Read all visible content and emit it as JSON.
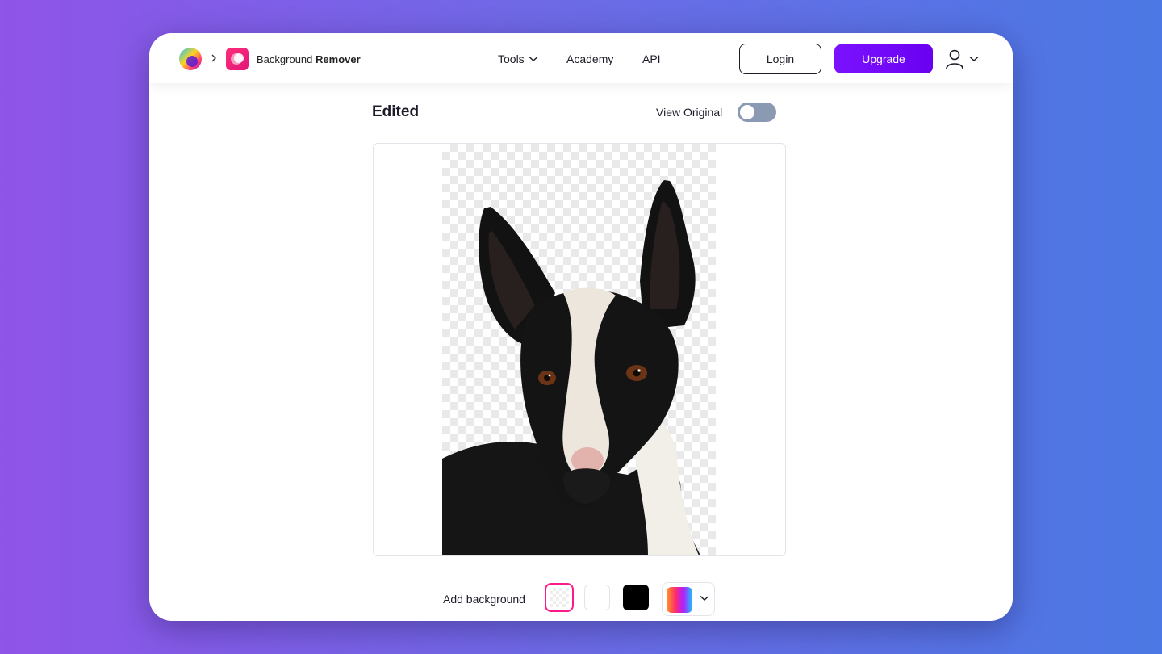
{
  "header": {
    "app_name_regular": "Background",
    "app_name_bold": "Remover",
    "nav": [
      {
        "label": "Tools"
      },
      {
        "label": "Academy"
      },
      {
        "label": "API"
      }
    ],
    "login_label": "Login",
    "upgrade_label": "Upgrade",
    "brand_icon": "brand-logo-icon",
    "app_icon": "background-remover-icon",
    "user_icon": "user-icon"
  },
  "editor": {
    "title": "Edited",
    "view_original_label": "View Original",
    "view_original_on": false
  },
  "background_picker": {
    "label": "Add background",
    "options": [
      {
        "name": "transparent",
        "selected": true
      },
      {
        "name": "white",
        "color": "#ffffff",
        "selected": false
      },
      {
        "name": "black",
        "color": "#000000",
        "selected": false
      },
      {
        "name": "more-colors",
        "selected": false
      }
    ]
  },
  "colors": {
    "accent": "#6a00f0",
    "selected_swatch_border": "#ff1a8c",
    "toggle_off": "#8a9ab3"
  }
}
